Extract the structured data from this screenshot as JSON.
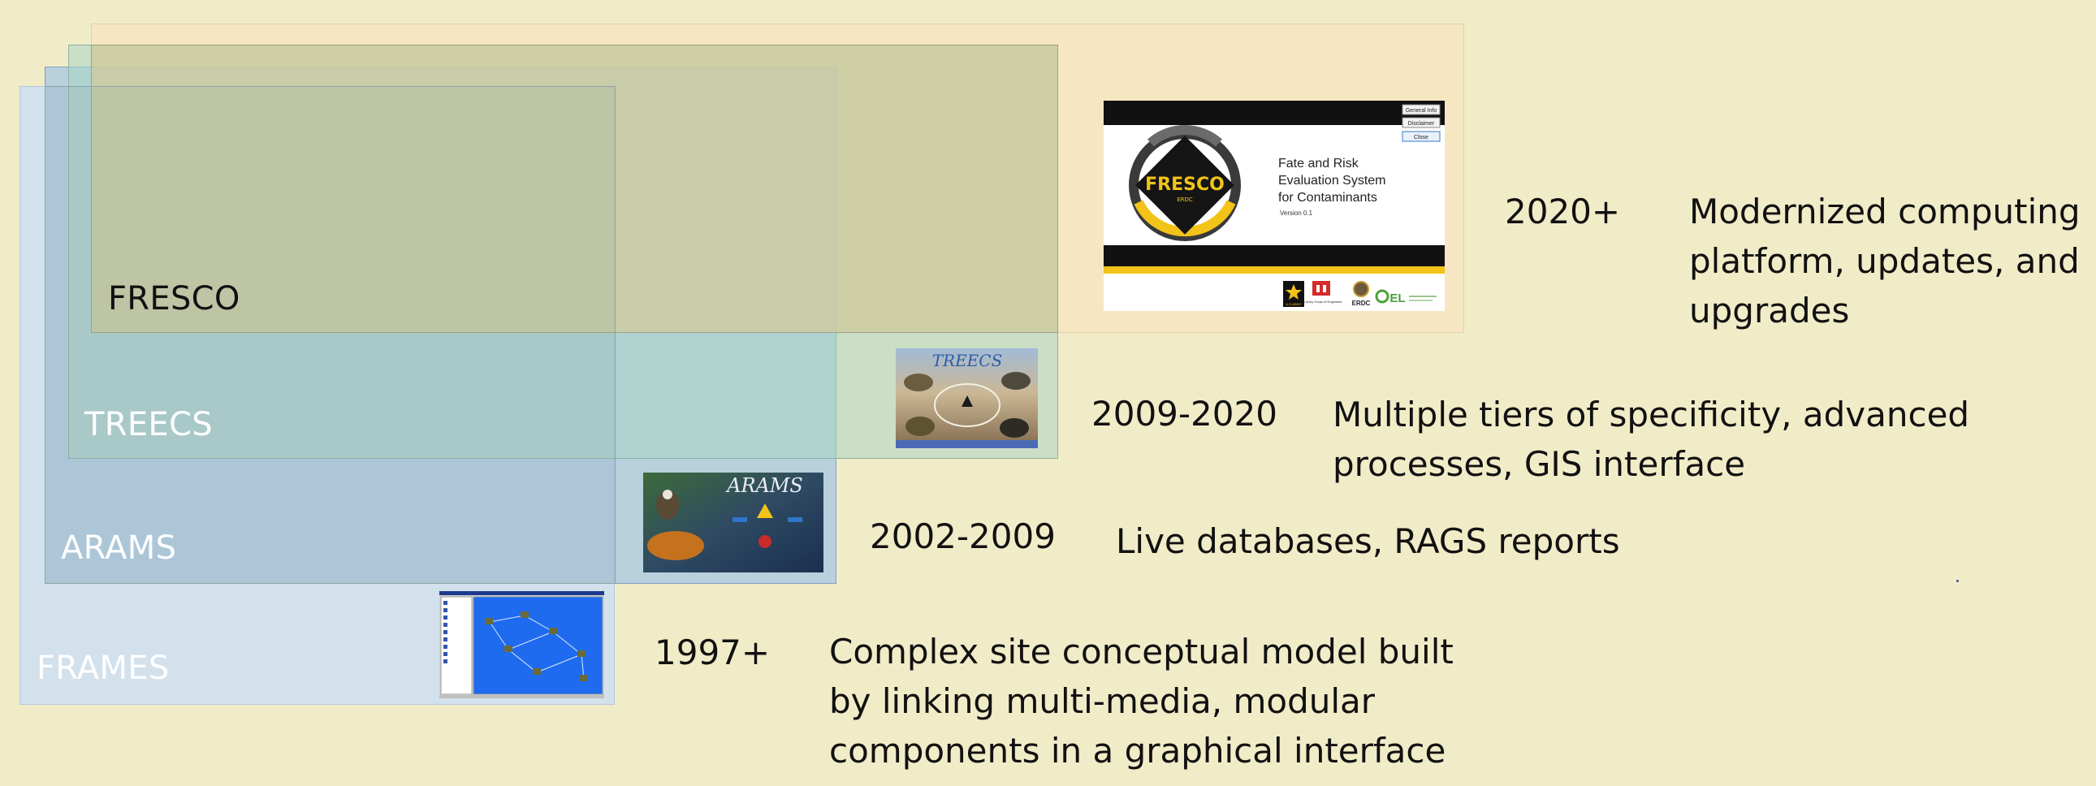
{
  "platforms": [
    {
      "key": "fresco",
      "label": "FRESCO",
      "years": "2020+",
      "description_lines": [
        "Modernized computing",
        "platform, updates, and",
        "upgrades"
      ]
    },
    {
      "key": "treecs",
      "label": "TREECS",
      "years": "2009-2020",
      "description_lines": [
        "Multiple tiers of specificity, advanced",
        "processes, GIS interface"
      ]
    },
    {
      "key": "arams",
      "label": "ARAMS",
      "years": "2002-2009",
      "description_lines": [
        "Live databases, RAGS reports"
      ]
    },
    {
      "key": "frames",
      "label": "FRAMES",
      "years": "1997+",
      "description_lines": [
        "Complex site conceptual model built",
        "by linking multi-media, modular",
        "components in a graphical interface"
      ]
    }
  ],
  "fresco_screenshot": {
    "buttons": [
      "General Info",
      "Disclaimer",
      "Close"
    ],
    "logo_text": "FRESCO",
    "logo_subtext": "ERDC",
    "title_lines": [
      "Fate and Risk",
      "Evaluation System",
      "for Contaminants"
    ],
    "version": "Version 0.1",
    "footer_logos": [
      "U.S.ARMY",
      "US Army Corps of Engineers",
      "ERDC",
      "EL"
    ]
  },
  "treecs_screenshot": {
    "logo_text": "TREECS"
  },
  "arams_screenshot": {
    "logo_text": "ARAMS"
  },
  "colors": {
    "background": "#f1ecc8",
    "frames_box": "#cedff2",
    "arams_box": "#a3c5e4",
    "treecs_box": "#aad6c4",
    "fresco_box": "#f8e4be",
    "label_light": "#ffffff",
    "label_dark": "#111111",
    "fresco_gold": "#f2c318"
  }
}
